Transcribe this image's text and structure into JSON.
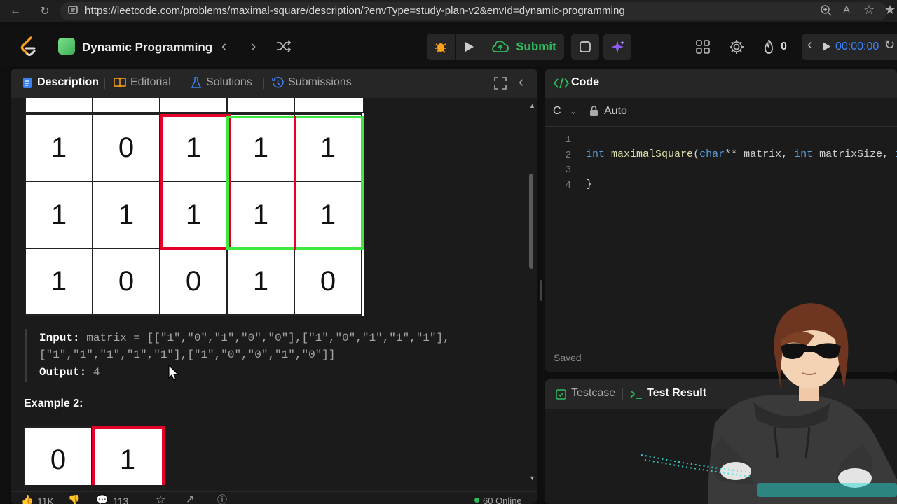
{
  "browser": {
    "url": "https://leetcode.com/problems/maximal-square/description/?envType=study-plan-v2&envId=dynamic-programming"
  },
  "topnav": {
    "study_plan_title": "Dynamic Programming",
    "submit_label": "Submit",
    "streak_count": "0",
    "timer": "00:00:00"
  },
  "description_panel": {
    "tabs": [
      "Description",
      "Editorial",
      "Solutions",
      "Submissions"
    ],
    "example1_grid": [
      [
        "1",
        "0",
        "1",
        "1",
        "1"
      ],
      [
        "1",
        "1",
        "1",
        "1",
        "1"
      ],
      [
        "1",
        "0",
        "0",
        "1",
        "0"
      ]
    ],
    "input_label": "Input:",
    "input_value_line1": "matrix = [[\"1\",\"0\",\"1\",\"0\",\"0\"],[\"1\",\"0\",\"1\",\"1\",\"1\"],",
    "input_value_line2": "[\"1\",\"1\",\"1\",\"1\",\"1\"],[\"1\",\"0\",\"0\",\"1\",\"0\"]]",
    "output_label": "Output:",
    "output_value": "4",
    "example2_title": "Example 2:",
    "example2_grid": [
      "0",
      "1"
    ]
  },
  "footer": {
    "likes": "11K",
    "comments": "113",
    "online": "60 Online"
  },
  "code_panel": {
    "title": "Code",
    "language": "C",
    "mode": "Auto",
    "lines": [
      {
        "num": "1",
        "text": ""
      },
      {
        "num": "2",
        "text": "int maximalSquare(char** matrix, int matrixSize, int"
      },
      {
        "num": "3",
        "text": ""
      },
      {
        "num": "4",
        "text": "}"
      }
    ],
    "saved_label": "Saved"
  },
  "test_panel": {
    "tabs": [
      "Testcase",
      "Test Result"
    ]
  },
  "colors": {
    "accent_green": "#2cbb5d",
    "highlight_red": "#e5002a",
    "highlight_green": "#3ee83e",
    "tab_blue": "#3b82f6"
  }
}
